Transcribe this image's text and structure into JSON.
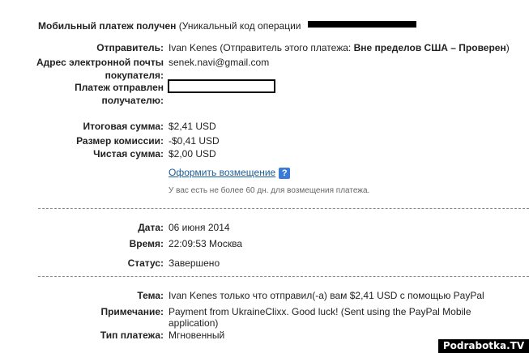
{
  "header": {
    "title": "Мобильный платеж получен",
    "code_prefix": "(Уникальный код операции"
  },
  "sender": {
    "label": "Отправитель:",
    "name": "Ivan Kenes",
    "note_prefix": "(Отправитель этого платежа:",
    "status": "Вне пределов США – Проверен",
    "note_suffix": ")"
  },
  "buyer_email": {
    "label_line1": "Адрес электронной почты",
    "label_line2": "покупателя:",
    "value": "senek.navi@gmail.com"
  },
  "recipient": {
    "label_line1": "Платеж отправлен",
    "label_line2": "получателю:"
  },
  "totals": {
    "total_label": "Итоговая сумма:",
    "total_value": "$2,41 USD",
    "fee_label": "Размер комиссии:",
    "fee_value": "-$0,41 USD",
    "net_label": "Чистая сумма:",
    "net_value": "$2,00 USD"
  },
  "refund": {
    "link": "Оформить возмещение",
    "help_icon": "question-help-icon",
    "help_glyph": "?",
    "note": "У вас есть не более 60 дн. для возмещения платежа."
  },
  "details": {
    "date_label": "Дата:",
    "date_value": "06 июня 2014",
    "time_label": "Время:",
    "time_value": "22:09:53 Москва",
    "status_label": "Статус:",
    "status_value": "Завершено"
  },
  "message": {
    "subject_label": "Тема:",
    "subject_value": "Ivan Kenes только что отправил(-а) вам $2,41 USD с помощью PayPal",
    "note_label": "Примечание:",
    "note_line1": "Payment from UkraineClixx. Good luck! (Sent using the PayPal Mobile",
    "note_line2": "application)",
    "type_label": "Тип платежа:",
    "type_value": "Мгновенный"
  },
  "watermark": "Podrabotka.TV",
  "colors": {
    "link": "#1b5e9a",
    "help_bg": "#3a7bd5",
    "separator": "#888888"
  }
}
